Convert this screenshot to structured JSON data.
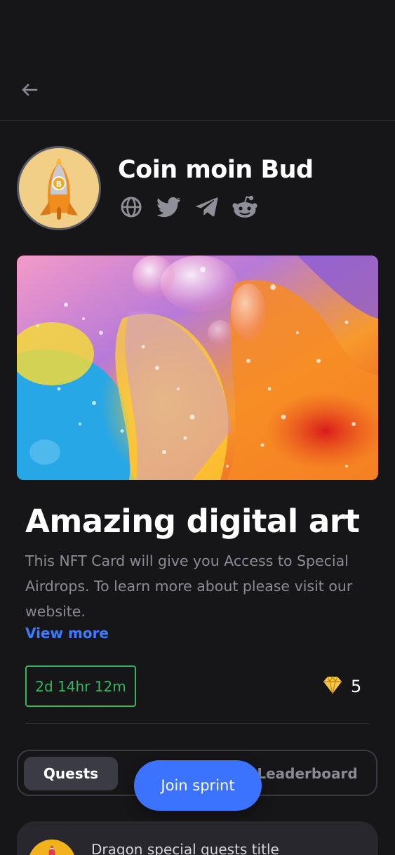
{
  "header": {
    "back_icon": "arrow-left-icon"
  },
  "profile": {
    "name": "Coin moin Bud",
    "avatar_icon": "rocket-bitcoin-avatar",
    "socials": [
      {
        "icon": "globe-icon"
      },
      {
        "icon": "twitter-icon"
      },
      {
        "icon": "telegram-icon"
      },
      {
        "icon": "reddit-icon"
      }
    ]
  },
  "hero": {
    "image": "abstract-colorful-bubbles-image"
  },
  "nft": {
    "title": "Amazing digital art",
    "description": "This NFT Card will give you Access to Special Airdrops. To learn more about please visit our website.",
    "view_more": "View more",
    "timer": "2d 14hr 12m",
    "gem_icon": "diamond-icon",
    "gem_count": "5"
  },
  "tabs": {
    "quests": "Quests",
    "leaderboard": "Leaderboard"
  },
  "cta": {
    "join": "Join sprint"
  },
  "quest_card": {
    "title": "Dragon special quests title",
    "icon": "dragon-icon"
  },
  "colors": {
    "background": "#161618",
    "accent_blue": "#3b73ff",
    "link_blue": "#3d7bff",
    "timer_green": "#35b75f",
    "muted_text": "#8b8b96",
    "gem_gold": "#f7c948"
  }
}
